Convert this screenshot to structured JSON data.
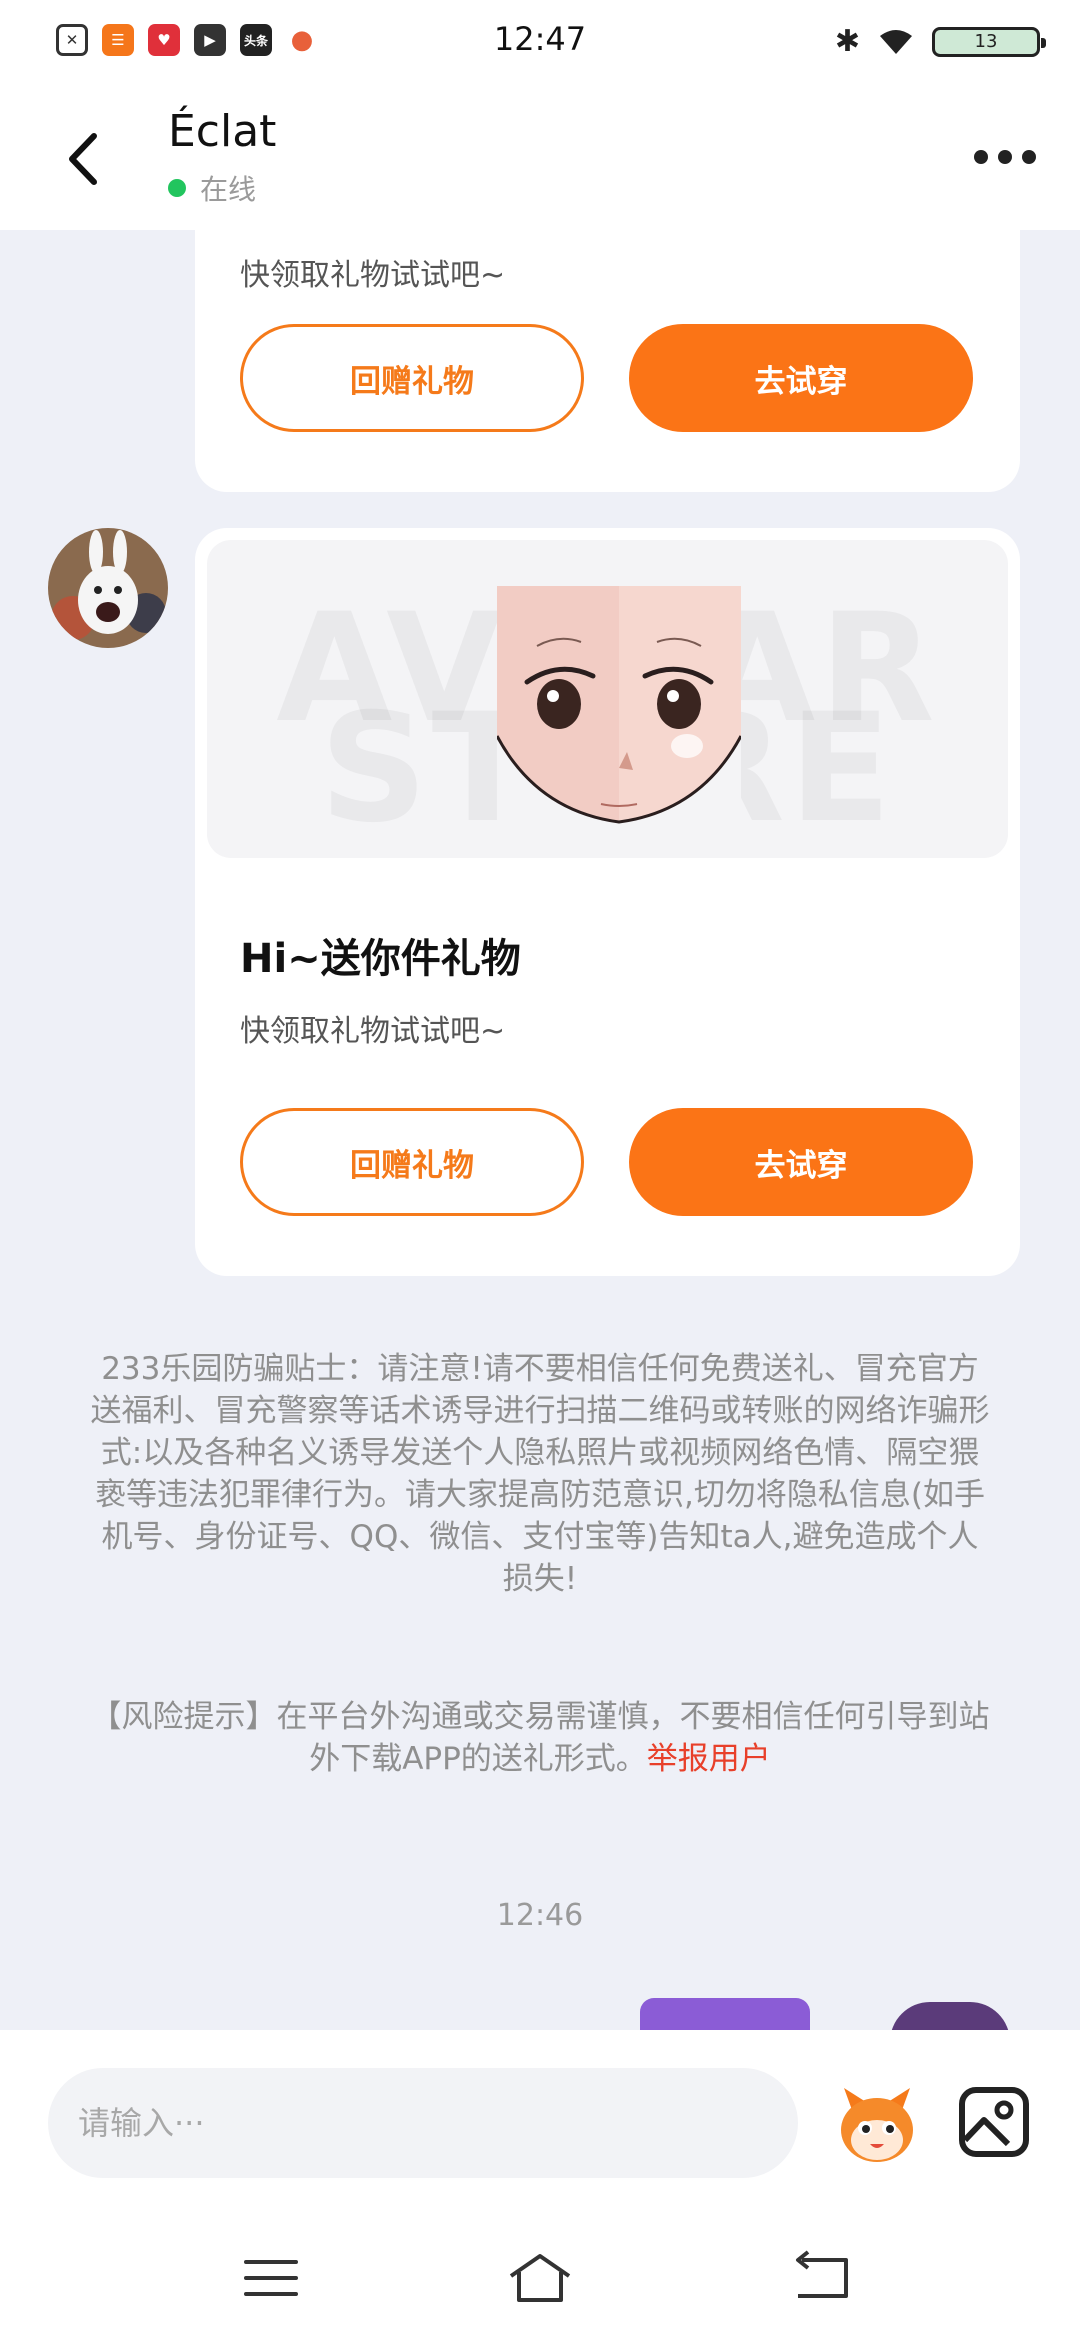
{
  "status_bar": {
    "time": "12:47",
    "battery": "13",
    "app_icons": [
      {
        "icon": "close-box-icon",
        "text": "✕",
        "color": "#ffffff"
      },
      {
        "icon": "app-orange-icon",
        "text": "☰",
        "color": "#f5761a"
      },
      {
        "icon": "app-red-icon",
        "text": "♥",
        "color": "#e0303a"
      },
      {
        "icon": "play-app-icon",
        "text": "▶",
        "color": "#333333"
      },
      {
        "icon": "toutiao-app-icon",
        "text": "头条",
        "color": "#222222"
      },
      {
        "icon": "mascot-app-icon",
        "text": "●",
        "color": "#e8603a"
      }
    ]
  },
  "header": {
    "contact_name": "Éclat",
    "status": "在线"
  },
  "cards": [
    {
      "subtitle": "快领取礼物试试吧~",
      "return_gift_label": "回赠礼物",
      "try_on_label": "去试穿"
    },
    {
      "preview_watermark_line1": "AVATAR",
      "preview_watermark_line2": "STORE",
      "title": "Hi~送你件礼物",
      "subtitle": "快领取礼物试试吧~",
      "return_gift_label": "回赠礼物",
      "try_on_label": "去试穿"
    }
  ],
  "notices": {
    "anti_fraud": "233乐园防骗贴士：请注意!请不要相信任何免费送礼、冒充官方送福利、冒充警察等话术诱导进行扫描二维码或转账的网络诈骗形式:以及各种名义诱导发送个人隐私照片或视频网络色情、隔空猥亵等违法犯罪律行为。请大家提高防范意识,切勿将隐私信息(如手机号、身份证号、QQ、微信、支付宝等)告知ta人,避免造成个人损失!",
    "risk_prefix": "【风险提示】在平台外沟通或交易需谨慎，不要相信任何引导到站外下载APP的送礼形式。",
    "report_label": "举报用户"
  },
  "chat_time": "12:46",
  "input": {
    "placeholder": "请输入···"
  },
  "colors": {
    "accent": "#fb7416",
    "report": "#e8402a",
    "online": "#22c55e"
  }
}
